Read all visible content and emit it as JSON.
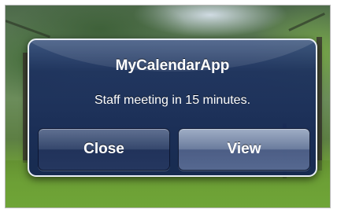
{
  "alert": {
    "title": "MyCalendarApp",
    "message": "Staff meeting in 15 minutes.",
    "buttons": [
      {
        "label": "Close",
        "role": "cancel"
      },
      {
        "label": "View",
        "role": "default"
      }
    ]
  },
  "colors": {
    "alert_background": "#1c3060",
    "alert_border": "#e9eef6",
    "text": "#ffffff"
  }
}
